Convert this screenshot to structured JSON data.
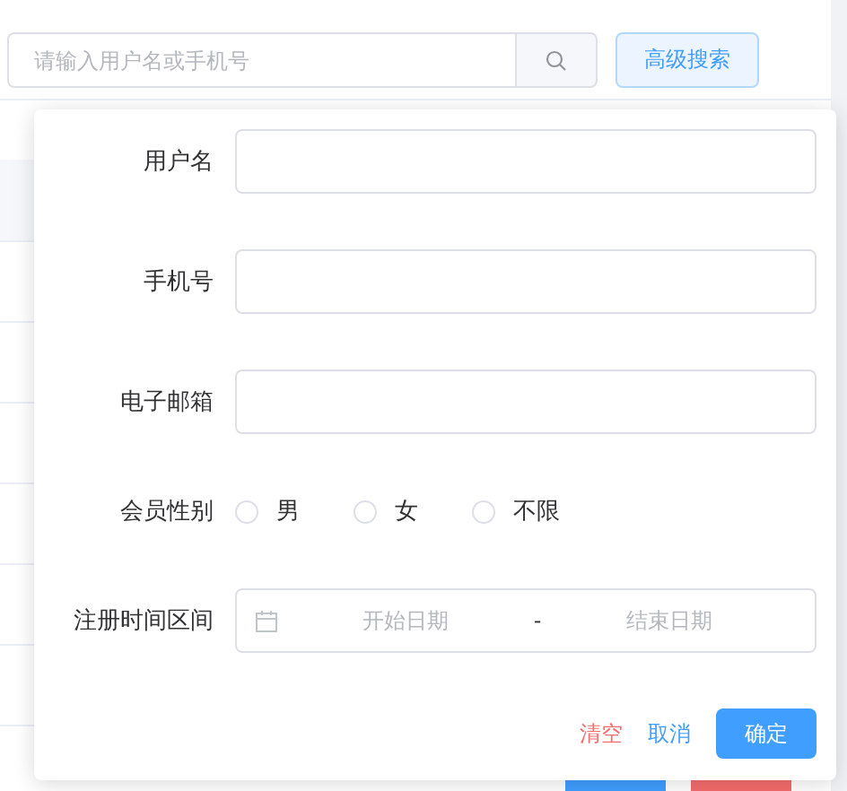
{
  "search": {
    "placeholder": "请输入用户名或手机号"
  },
  "advanced_button": "高级搜索",
  "popover": {
    "fields": [
      {
        "kind": "text",
        "label": "用户名"
      },
      {
        "kind": "text",
        "label": "手机号"
      },
      {
        "kind": "text",
        "label": "电子邮箱"
      },
      {
        "kind": "radio",
        "label": "会员性别",
        "options": [
          {
            "label": "男",
            "selected": false
          },
          {
            "label": "女",
            "selected": false
          },
          {
            "label": "不限",
            "selected": false
          }
        ]
      },
      {
        "kind": "daterange",
        "label": "注册时间区间",
        "start_placeholder": "开始日期",
        "separator": "-",
        "end_placeholder": "结束日期"
      }
    ],
    "buttons": [
      {
        "kind": "danger-link",
        "label": "清空"
      },
      {
        "kind": "link",
        "label": "取消"
      },
      {
        "kind": "primary",
        "label": "确定"
      }
    ]
  }
}
